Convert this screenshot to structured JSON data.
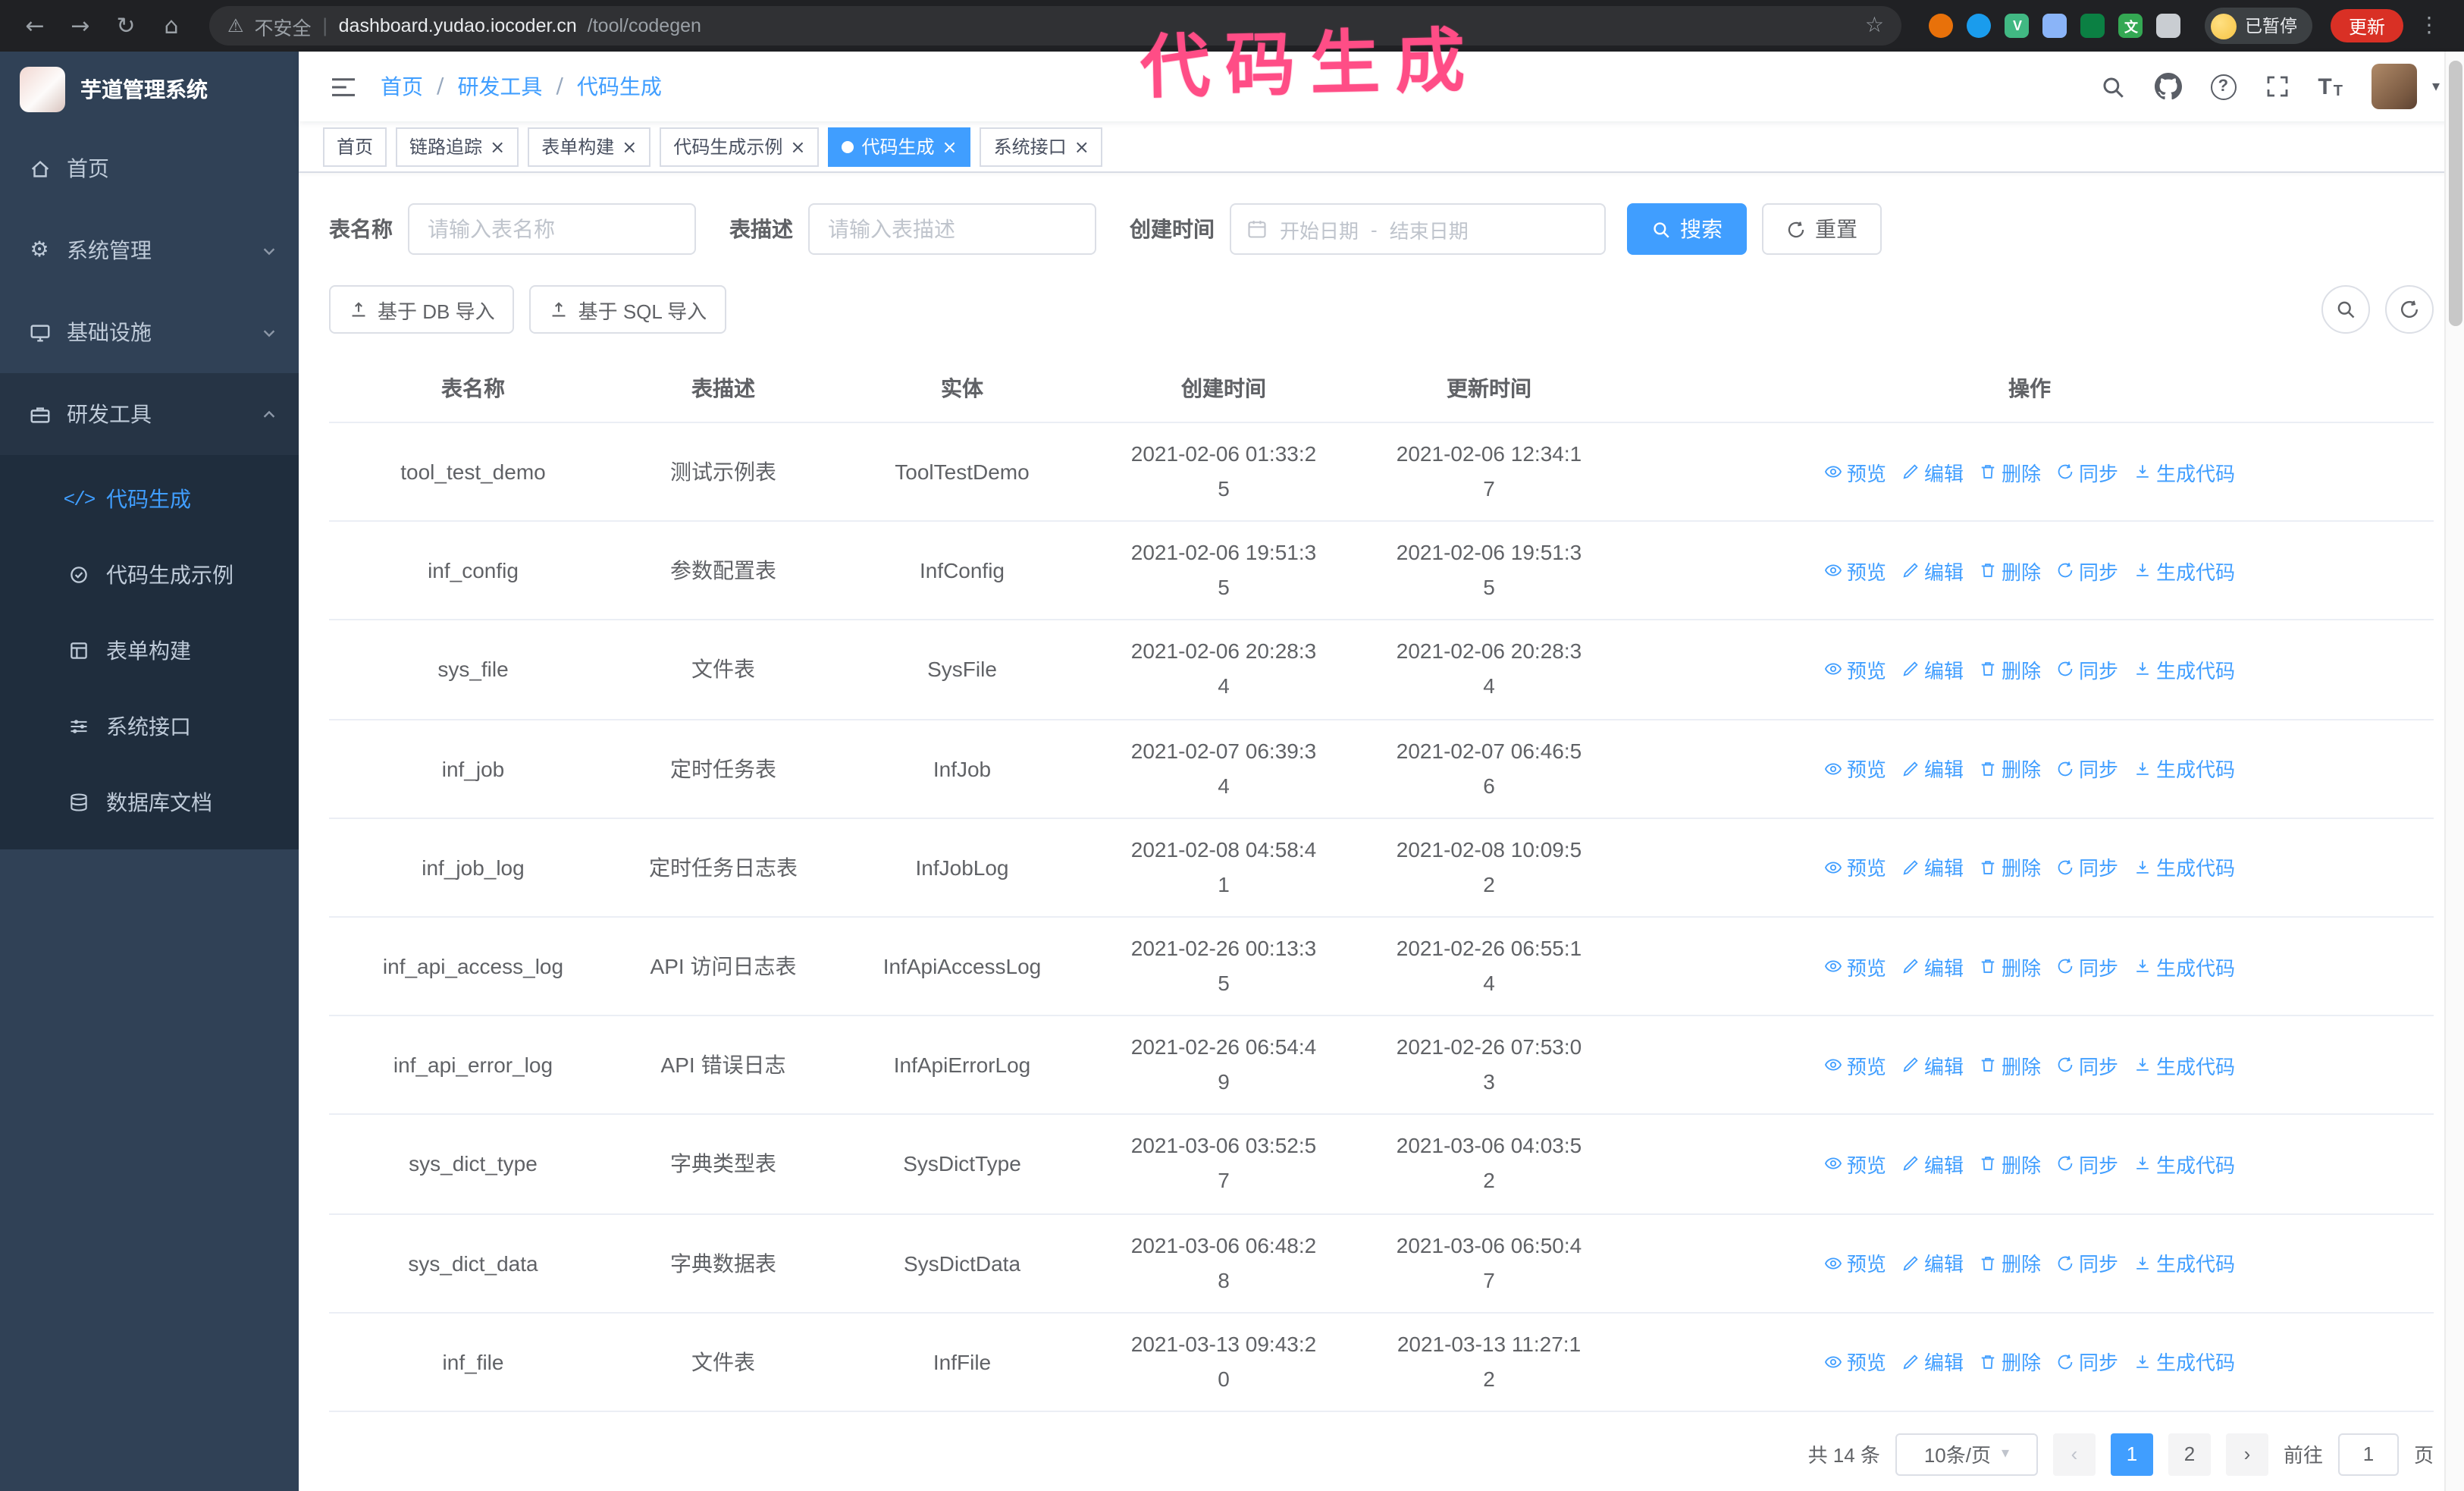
{
  "colors": {
    "primary": "#409eff",
    "sidebar_bg": "#304156",
    "submenu_bg": "#1f2d3d",
    "chrome_bg": "#202124",
    "update_red": "#d93025",
    "tag_active": "#409eff",
    "annotation_pink": "#ff4d86"
  },
  "glyphs": {
    "back": "←",
    "forward": "→",
    "reload": "↻",
    "home": "⌂",
    "warning": "⚠",
    "divider": "|",
    "star": "☆",
    "dots": "⋮",
    "caret_down": "▾",
    "close": "×",
    "slash": "/",
    "question": "?",
    "t_large": "T",
    "t_small": "T",
    "code": "</>",
    "prev": "‹",
    "next": "›"
  },
  "annotation": {
    "text": "代码生成"
  },
  "browser": {
    "security_label": "不安全",
    "url_host": "dashboard.yudao.iocoder.cn",
    "url_path": "/tool/codegen",
    "paused_label": "已暂停",
    "update_label": "更新",
    "extensions": [
      {
        "name": "fox-extension-icon",
        "color": "#e8710a",
        "shape": "circle",
        "letter": ""
      },
      {
        "name": "drop-extension-icon",
        "color": "#1a9ced",
        "shape": "circle",
        "letter": ""
      },
      {
        "name": "vue-devtools-icon",
        "color": "#41b883",
        "shape": "square",
        "letter": "V"
      },
      {
        "name": "people-extension-icon",
        "color": "#8ab4f8",
        "shape": "square",
        "letter": ""
      },
      {
        "name": "capture-extension-icon",
        "color": "#0b8043",
        "shape": "square",
        "letter": ""
      },
      {
        "name": "translate-extension-icon",
        "color": "#34a853",
        "shape": "square",
        "letter": "文"
      },
      {
        "name": "puzzle-extension-icon",
        "color": "#c9cdd2",
        "shape": "square",
        "letter": ""
      }
    ]
  },
  "sidebar": {
    "logo_title": "芋道管理系统",
    "items": [
      {
        "label": "首页"
      },
      {
        "label": "系统管理"
      },
      {
        "label": "基础设施"
      },
      {
        "label": "研发工具",
        "children": [
          {
            "label": "代码生成"
          },
          {
            "label": "代码生成示例"
          },
          {
            "label": "表单构建"
          },
          {
            "label": "系统接口"
          },
          {
            "label": "数据库文档"
          }
        ]
      }
    ]
  },
  "navbar": {
    "breadcrumb": [
      "首页",
      "研发工具",
      "代码生成"
    ]
  },
  "tags": [
    {
      "label": "首页"
    },
    {
      "label": "链路追踪"
    },
    {
      "label": "表单构建"
    },
    {
      "label": "代码生成示例"
    },
    {
      "label": "代码生成"
    },
    {
      "label": "系统接口"
    }
  ],
  "search": {
    "table_name_label": "表名称",
    "table_name_placeholder": "请输入表名称",
    "table_desc_label": "表描述",
    "table_desc_placeholder": "请输入表描述",
    "create_time_label": "创建时间",
    "date_start_placeholder": "开始日期",
    "date_separator": "-",
    "date_end_placeholder": "结束日期",
    "search_label": "搜索",
    "reset_label": "重置"
  },
  "toolbar": {
    "import_db_label": "基于 DB 导入",
    "import_sql_label": "基于 SQL 导入"
  },
  "table": {
    "columns": [
      "表名称",
      "表描述",
      "实体",
      "创建时间",
      "更新时间",
      "操作"
    ],
    "actions": [
      "预览",
      "编辑",
      "删除",
      "同步",
      "生成代码"
    ],
    "rows": [
      {
        "name": "tool_test_demo",
        "desc": "测试示例表",
        "entity": "ToolTestDemo",
        "created": "2021-02-06 01:33:25",
        "updated": "2021-02-06 12:34:17"
      },
      {
        "name": "inf_config",
        "desc": "参数配置表",
        "entity": "InfConfig",
        "created": "2021-02-06 19:51:35",
        "updated": "2021-02-06 19:51:35"
      },
      {
        "name": "sys_file",
        "desc": "文件表",
        "entity": "SysFile",
        "created": "2021-02-06 20:28:34",
        "updated": "2021-02-06 20:28:34"
      },
      {
        "name": "inf_job",
        "desc": "定时任务表",
        "entity": "InfJob",
        "created": "2021-02-07 06:39:34",
        "updated": "2021-02-07 06:46:56"
      },
      {
        "name": "inf_job_log",
        "desc": "定时任务日志表",
        "entity": "InfJobLog",
        "created": "2021-02-08 04:58:41",
        "updated": "2021-02-08 10:09:52"
      },
      {
        "name": "inf_api_access_log",
        "desc": "API 访问日志表",
        "entity": "InfApiAccessLog",
        "created": "2021-02-26 00:13:35",
        "updated": "2021-02-26 06:55:14"
      },
      {
        "name": "inf_api_error_log",
        "desc": "API 错误日志",
        "entity": "InfApiErrorLog",
        "created": "2021-02-26 06:54:49",
        "updated": "2021-02-26 07:53:03"
      },
      {
        "name": "sys_dict_type",
        "desc": "字典类型表",
        "entity": "SysDictType",
        "created": "2021-03-06 03:52:57",
        "updated": "2021-03-06 04:03:52"
      },
      {
        "name": "sys_dict_data",
        "desc": "字典数据表",
        "entity": "SysDictData",
        "created": "2021-03-06 06:48:28",
        "updated": "2021-03-06 06:50:47"
      },
      {
        "name": "inf_file",
        "desc": "文件表",
        "entity": "InfFile",
        "created": "2021-03-13 09:43:20",
        "updated": "2021-03-13 11:27:12"
      }
    ]
  },
  "pagination": {
    "total_label": "共 14 条",
    "page_size": "10条/页",
    "pages": [
      "1",
      "2"
    ],
    "active_page": "1",
    "goto_label": "前往",
    "goto_value": "1",
    "page_unit": "页"
  }
}
